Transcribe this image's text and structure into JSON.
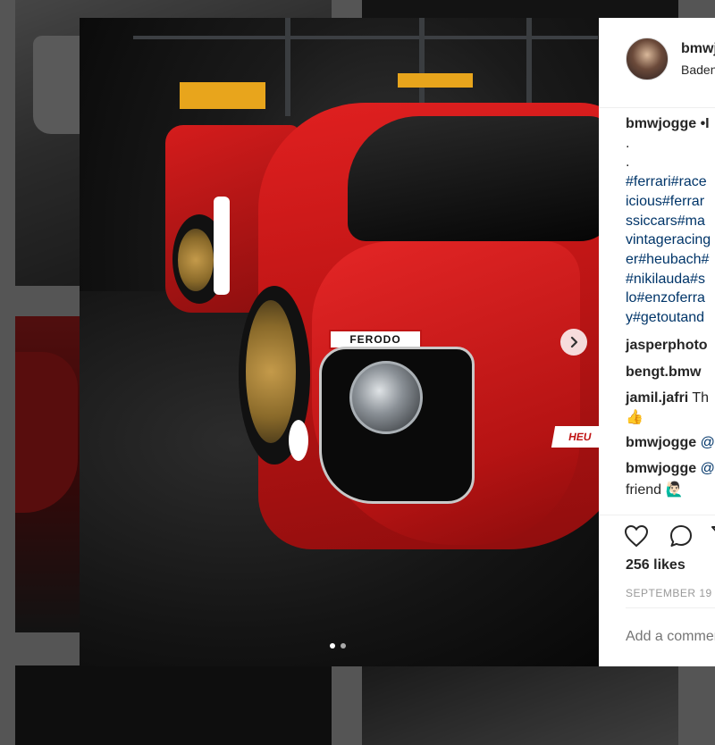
{
  "post": {
    "username": "bmwjogge",
    "location": "Baden",
    "caption_user": "bmwjogge",
    "caption_text": "•I",
    "caption_dot1": ".",
    "caption_dot2": ".",
    "hashtag_lines": [
      "#ferrari#race",
      "icious#ferrar",
      "ssiccars#ma",
      "vintageracing",
      "er#heubach#",
      "#nikilauda#s",
      "lo#enzoferra",
      "y#getoutand"
    ],
    "comments": [
      {
        "user": "jasperphoto",
        "text": ""
      },
      {
        "user": "bengt.bmw",
        "text": ""
      },
      {
        "user": "jamil.jafri",
        "text": "Th"
      },
      {
        "user": "",
        "text": "👍"
      },
      {
        "user": "bmwjogge",
        "text": "@"
      },
      {
        "user": "bmwjogge",
        "text": "@"
      },
      {
        "user": "",
        "text": "friend 🙋🏻‍♂"
      }
    ],
    "likes": "256 likes",
    "date": "SEPTEMBER 19",
    "add_comment_placeholder": "Add a comment..."
  },
  "photo": {
    "sticker_ferodo": "FERODO",
    "sticker_heuer": "HEU"
  },
  "icons": {
    "like": "heart-icon",
    "comment": "comment-bubble-icon",
    "share": "share-icon",
    "next": "chevron-right-icon"
  },
  "carousel": {
    "count": 2,
    "active": 1
  }
}
